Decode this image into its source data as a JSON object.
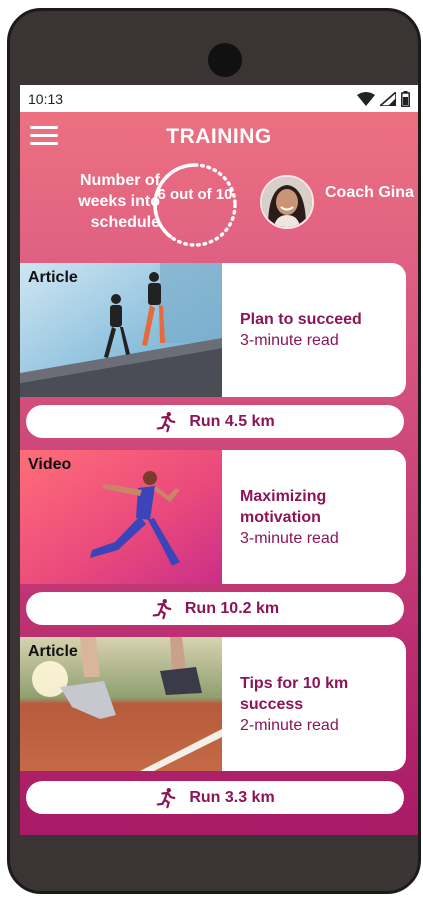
{
  "status_bar": {
    "time": "10:13"
  },
  "header": {
    "title": "TRAINING",
    "menu_icon": "hamburger-menu-icon"
  },
  "progress": {
    "label": "Number of weeks into schedule",
    "text": "6 out of 10",
    "value": 6,
    "total": 10
  },
  "coach": {
    "name": "Coach Gina"
  },
  "cards": [
    {
      "type": "Article",
      "title": "Plan to succeed",
      "read_time": "3-minute read",
      "run_label": "Run 4.5 km"
    },
    {
      "type": "Video",
      "title": "Maximizing motivation",
      "read_time": "3-minute read",
      "run_label": "Run 10.2 km"
    },
    {
      "type": "Article",
      "title": "Tips for 10 km success",
      "read_time": "2-minute read",
      "run_label": "Run 3.3 km"
    }
  ],
  "colors": {
    "accent": "#8c1558",
    "header_top": "#ef7480",
    "header_bottom": "#a91a66"
  }
}
